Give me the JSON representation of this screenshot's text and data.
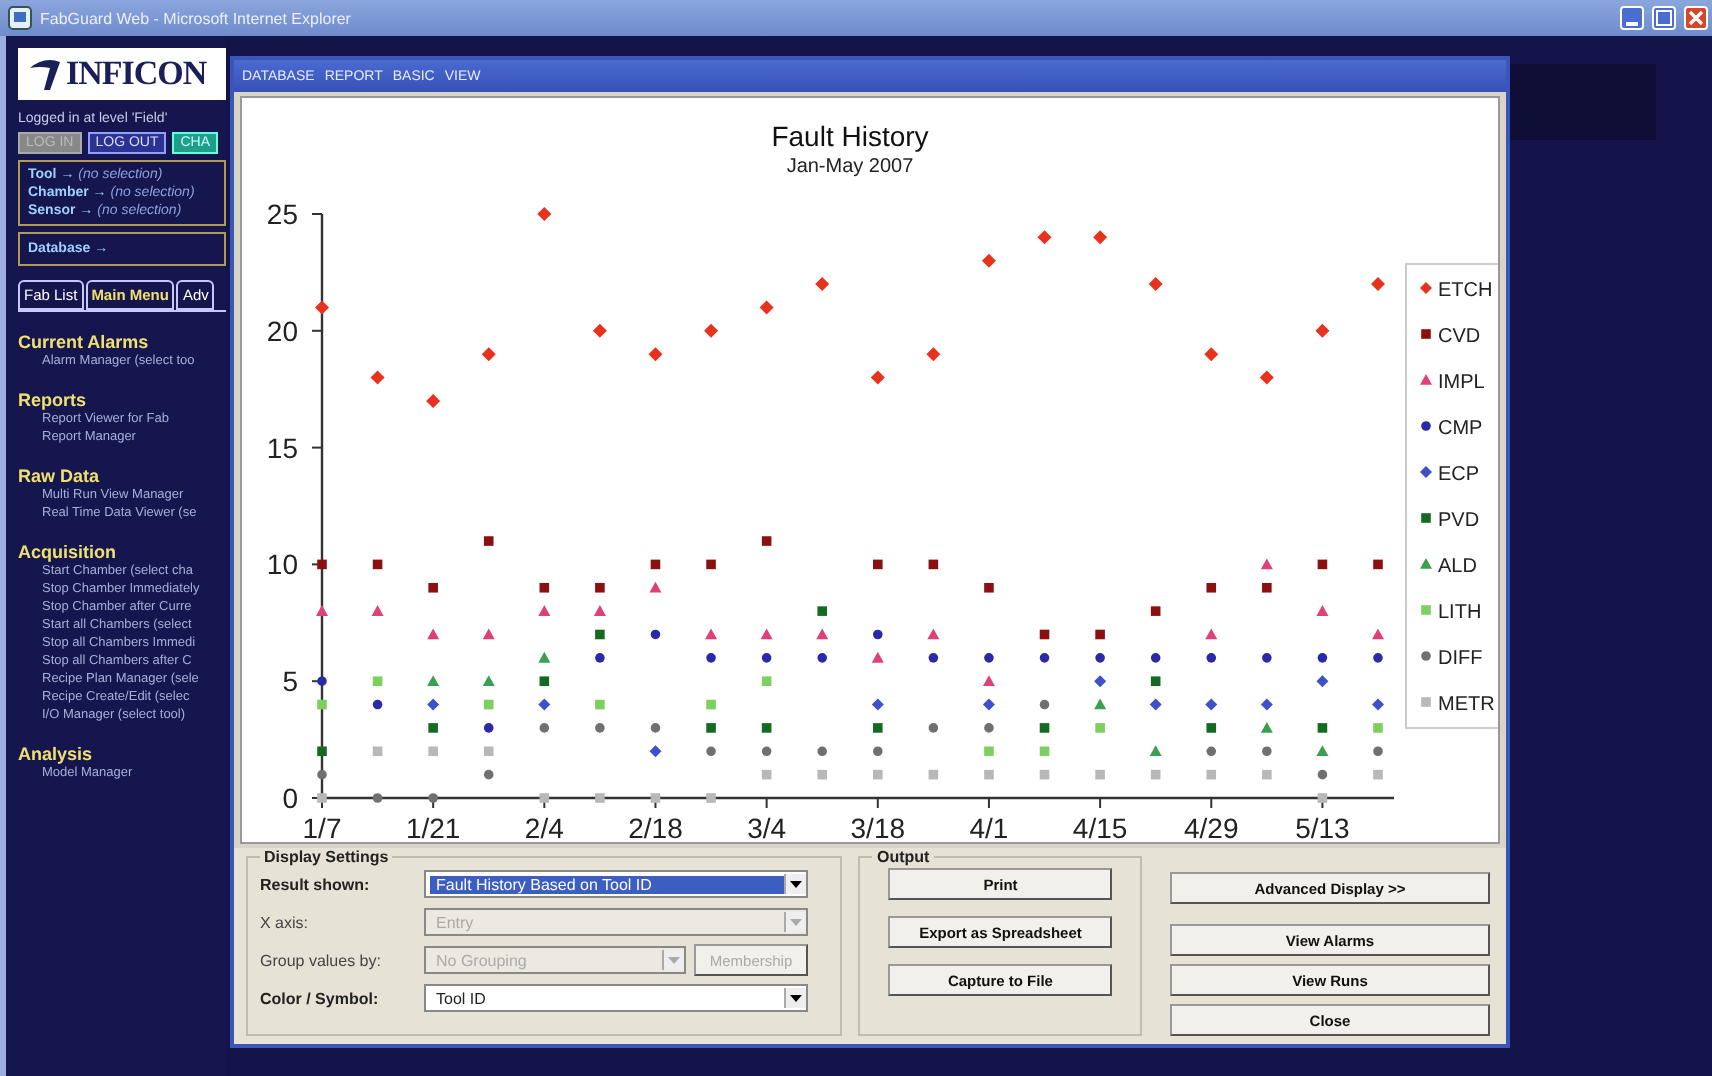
{
  "window": {
    "title": "FabGuard Web - Microsoft Internet Explorer"
  },
  "sidebar": {
    "logo": "INFICON",
    "login_status": "Logged in at level 'Field'",
    "buttons": [
      {
        "label": "LOG IN",
        "disabled": true
      },
      {
        "label": "LOG OUT",
        "disabled": false
      },
      {
        "label": "CHA",
        "disabled": false
      }
    ],
    "selections": [
      {
        "label": "Tool →",
        "value": "(no selection)"
      },
      {
        "label": "Chamber →",
        "value": "(no selection)"
      },
      {
        "label": "Sensor →",
        "value": "(no selection)"
      }
    ],
    "database": "Database →",
    "tabs": [
      {
        "label": "Fab List",
        "selected": false
      },
      {
        "label": "Main Menu",
        "selected": true
      },
      {
        "label": "Adv",
        "selected": false
      }
    ],
    "sections": [
      {
        "title": "Current Alarms",
        "items": [
          "Alarm Manager (select too"
        ]
      },
      {
        "title": "Reports",
        "items": [
          "Report Viewer for Fab",
          "Report Manager"
        ]
      },
      {
        "title": "Raw Data",
        "items": [
          "Multi Run View Manager",
          "Real Time Data Viewer (se"
        ]
      },
      {
        "title": "Acquisition",
        "items": [
          "Start Chamber (select cha",
          "Stop Chamber Immediately",
          "Stop Chamber after Curre",
          "Start all Chambers (select",
          "Stop all Chambers Immedi",
          "Stop all Chambers after C",
          "Recipe Plan Manager (sele",
          "Recipe Create/Edit (selec",
          "I/O Manager (select tool)"
        ]
      },
      {
        "title": "Analysis",
        "items": [
          "Model Manager"
        ]
      }
    ]
  },
  "dialog": {
    "menu": [
      "DATABASE",
      "REPORT",
      "BASIC",
      "VIEW"
    ],
    "chart_data": {
      "type": "scatter",
      "title": "Fault History",
      "subtitle": "Jan-May 2007",
      "categories": [
        "1/7",
        null,
        "1/21",
        null,
        "2/4",
        null,
        "2/18",
        null,
        "3/4",
        null,
        "3/18",
        null,
        "4/1",
        null,
        "4/15",
        null,
        "4/29",
        null,
        "5/13",
        null
      ],
      "ylim": [
        0,
        25
      ],
      "legend": "right",
      "yticks": [
        0,
        5,
        10,
        15,
        20,
        25
      ],
      "series": [
        {
          "name": "ETCH",
          "color": "#e8321e",
          "values": [
            21,
            18,
            17,
            19,
            25,
            20,
            19,
            20,
            21,
            22,
            18,
            19,
            23,
            24,
            24,
            22,
            19,
            18,
            20,
            22
          ]
        },
        {
          "name": "CVD",
          "color": "#8b1010",
          "values": [
            10,
            10,
            9,
            11,
            9,
            9,
            10,
            10,
            11,
            null,
            10,
            10,
            9,
            7,
            7,
            8,
            9,
            9,
            10,
            10
          ]
        },
        {
          "name": "IMPL",
          "color": "#e0407a",
          "values": [
            8,
            8,
            7,
            7,
            8,
            8,
            9,
            7,
            7,
            7,
            6,
            7,
            5,
            null,
            null,
            null,
            7,
            10,
            8,
            7
          ]
        },
        {
          "name": "CMP",
          "color": "#2a2aa8",
          "values": [
            5,
            4,
            null,
            3,
            null,
            6,
            7,
            6,
            6,
            6,
            7,
            6,
            6,
            6,
            6,
            6,
            6,
            6,
            6,
            6
          ]
        },
        {
          "name": "ECP",
          "color": "#4050c8",
          "values": [
            null,
            null,
            4,
            null,
            4,
            null,
            2,
            null,
            null,
            null,
            4,
            null,
            4,
            null,
            5,
            4,
            4,
            4,
            5,
            4
          ]
        },
        {
          "name": "PVD",
          "color": "#136b22",
          "values": [
            2,
            null,
            3,
            null,
            5,
            7,
            null,
            3,
            3,
            8,
            3,
            null,
            null,
            3,
            null,
            5,
            3,
            null,
            3,
            null
          ]
        },
        {
          "name": "ALD",
          "color": "#3aa050",
          "values": [
            null,
            null,
            5,
            5,
            6,
            null,
            null,
            null,
            null,
            null,
            null,
            null,
            null,
            null,
            4,
            2,
            null,
            3,
            2,
            null
          ]
        },
        {
          "name": "LITH",
          "color": "#7cd060",
          "values": [
            4,
            5,
            null,
            4,
            null,
            4,
            null,
            4,
            5,
            null,
            null,
            null,
            2,
            2,
            3,
            null,
            null,
            null,
            null,
            3
          ]
        },
        {
          "name": "DIFF",
          "color": "#707070",
          "values": [
            1,
            0,
            0,
            1,
            3,
            3,
            3,
            2,
            2,
            2,
            2,
            3,
            3,
            4,
            null,
            null,
            2,
            2,
            1,
            2
          ]
        },
        {
          "name": "METR",
          "color": "#b8b8b8",
          "values": [
            0,
            2,
            2,
            2,
            0,
            0,
            0,
            0,
            1,
            1,
            1,
            1,
            1,
            1,
            1,
            1,
            1,
            1,
            0,
            1
          ]
        }
      ]
    },
    "display_settings": {
      "title": "Display Settings",
      "fields": [
        {
          "label": "Result shown:",
          "value": "Fault History Based on Tool ID",
          "disabled": false,
          "selected": true
        },
        {
          "label": "X axis:",
          "value": "Entry",
          "disabled": true,
          "selected": false
        },
        {
          "label": "Group values by:",
          "value": "No Grouping",
          "disabled": true,
          "selected": false,
          "button": "Membership"
        },
        {
          "label": "Color / Symbol:",
          "value": "Tool ID",
          "disabled": false,
          "selected": false
        }
      ]
    },
    "output": {
      "title": "Output",
      "buttons": [
        "Print",
        "Export as Spreadsheet",
        "Capture to File"
      ]
    },
    "actions": [
      "Advanced Display  >>",
      "View Alarms",
      "View Runs",
      "Close"
    ]
  }
}
